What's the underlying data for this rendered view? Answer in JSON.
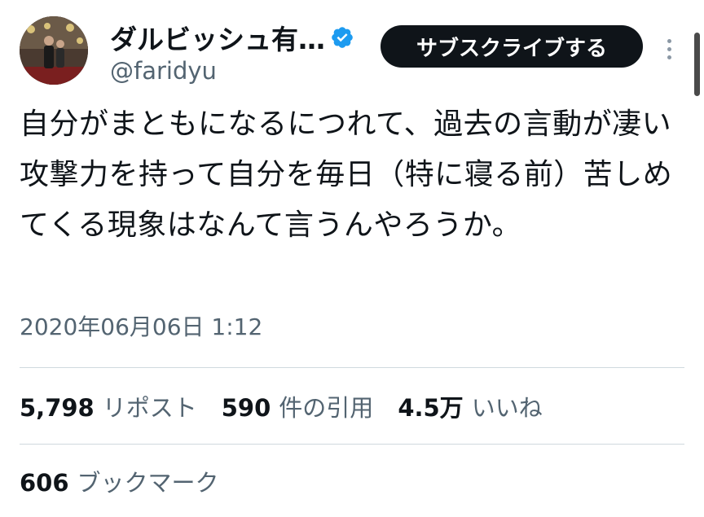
{
  "tweet": {
    "author": {
      "display_name": "ダルビッシュ有…",
      "handle": "@faridyu",
      "verified": true
    },
    "subscribe_label": "サブスクライブする",
    "more_icon": "more-vertical-icon",
    "text": "自分がまともになるにつれて、過去の言動が凄い攻撃力を持って自分を毎日（特に寝る前）苦しめてくる現象はなんて言うんやろうか。",
    "timestamp": "2020年06月06日 1:12",
    "stats": {
      "reposts": {
        "count": "5,798",
        "label": "リポスト"
      },
      "quotes": {
        "count": "590",
        "label": "件の引用"
      },
      "likes": {
        "count": "4.5万",
        "label": "いいね"
      },
      "bookmarks": {
        "count": "606",
        "label": "ブックマーク"
      }
    }
  },
  "colors": {
    "text_primary": "#0f1419",
    "text_secondary": "#536471",
    "divider": "#cfd9de",
    "verified_badge": "#1d9bf0",
    "subscribe_button_bg": "#0f1419"
  }
}
